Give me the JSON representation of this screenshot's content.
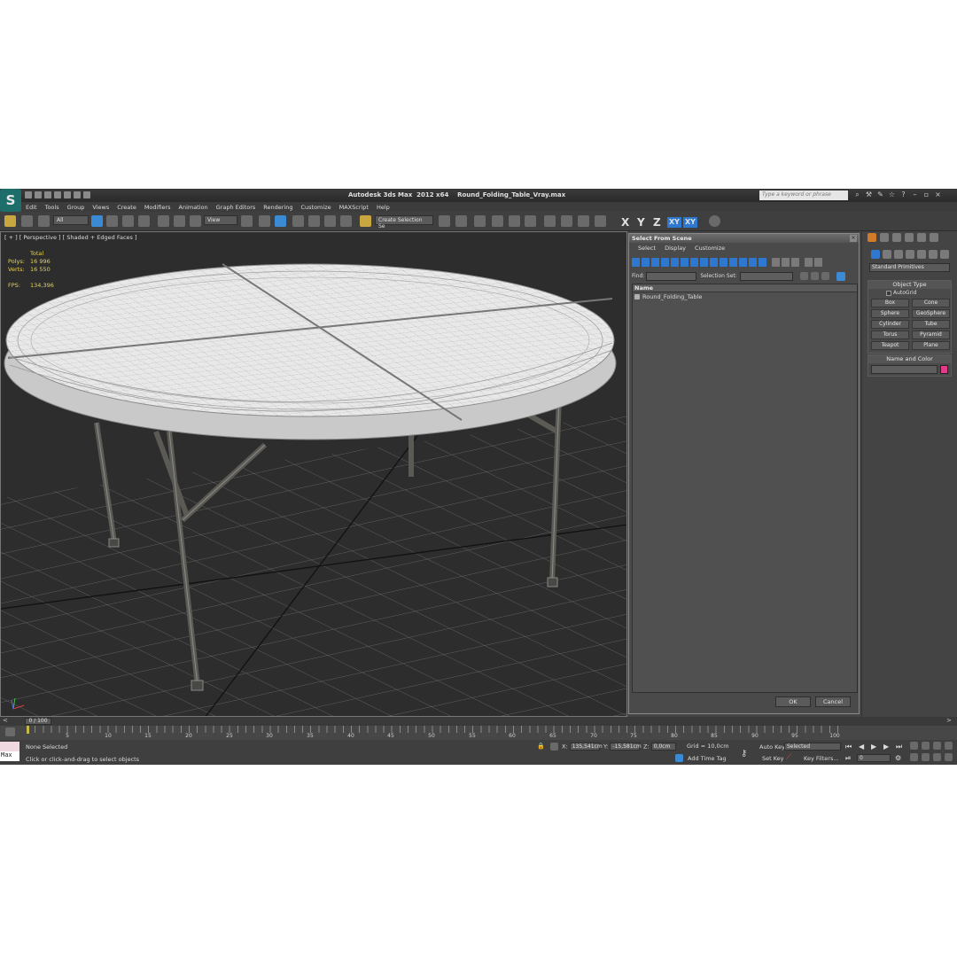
{
  "window": {
    "title_app": "Autodesk 3ds Max  2012 x64",
    "title_file": "Round_Folding_Table_Vray.max",
    "search_placeholder": "Type a keyword or phrase"
  },
  "menu": [
    "Edit",
    "Tools",
    "Group",
    "Views",
    "Create",
    "Modifiers",
    "Animation",
    "Graph Editors",
    "Rendering",
    "Customize",
    "MAXScript",
    "Help"
  ],
  "toolbar": {
    "filter_value": "All",
    "refcoord_value": "View",
    "named_selection_value": "Create Selection Se",
    "axis_x": "X",
    "axis_y": "Y",
    "axis_z": "Z",
    "axis_xy": "XY",
    "axis_xy2": "XY"
  },
  "viewport": {
    "label": "[ + ] [ Perspective ] [ Shaded + Edged Faces ]",
    "stats": {
      "total_label": "Total",
      "polys_label": "Polys:",
      "polys_value": "16 996",
      "verts_label": "Verts:",
      "verts_value": "16 550",
      "fps_label": "FPS:",
      "fps_value": "134,396"
    }
  },
  "dialog": {
    "title": "Select From Scene",
    "menu": [
      "Select",
      "Display",
      "Customize"
    ],
    "find_label": "Find:",
    "selection_set_label": "Selection Set:",
    "column_name": "Name",
    "items": [
      "Round_Folding_Table"
    ],
    "ok": "OK",
    "cancel": "Cancel"
  },
  "command_panel": {
    "category": "Standard Primitives",
    "object_type_title": "Object Type",
    "autogrid": "AutoGrid",
    "primitives": [
      "Box",
      "Cone",
      "Sphere",
      "GeoSphere",
      "Cylinder",
      "Tube",
      "Torus",
      "Pyramid",
      "Teapot",
      "Plane"
    ],
    "name_and_color_title": "Name and Color"
  },
  "timeline": {
    "slider": "0 / 100",
    "ticks": [
      "5",
      "10",
      "15",
      "20",
      "25",
      "30",
      "35",
      "40",
      "45",
      "50",
      "55",
      "60",
      "65",
      "70",
      "75",
      "80",
      "85",
      "90",
      "95",
      "100"
    ]
  },
  "status": {
    "maxscript": "Max",
    "selection": "None Selected",
    "prompt": "Click or click-and-drag to select objects",
    "x_label": "X:",
    "x_value": "135,541cm",
    "y_label": "Y:",
    "y_value": "-15,581cm",
    "z_label": "Z:",
    "z_value": "0,0cm",
    "grid": "Grid = 10,0cm",
    "add_time_tag": "Add Time Tag",
    "auto_key": "Auto Key",
    "set_key": "Set Key",
    "key_mode_value": "Selected",
    "key_filters": "Key Filters...",
    "frame_value": "0"
  }
}
